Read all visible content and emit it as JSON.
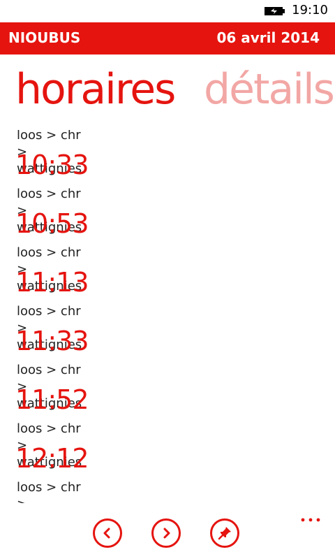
{
  "status_bar": {
    "time": "19:10",
    "battery_icon": "battery-charging-icon"
  },
  "app_bar": {
    "title": "NIOUBUS",
    "date": "06 avril 2014",
    "color": "#e5140f"
  },
  "pivot": {
    "tabs": [
      {
        "label": "horaires",
        "active": true
      },
      {
        "label": "détails",
        "active": false
      }
    ],
    "active_color": "#e5140f",
    "inactive_color": "#f2a7a5"
  },
  "schedule": {
    "partial_top_route": "loos > chr > wattignies",
    "items": [
      {
        "time": "10:33",
        "route": "loos > chr > wattignies"
      },
      {
        "time": "10:53",
        "route": "loos > chr > wattignies"
      },
      {
        "time": "11:13",
        "route": "loos > chr > wattignies"
      },
      {
        "time": "11:33",
        "route": "loos > chr > wattignies"
      },
      {
        "time": "11:52",
        "route": "loos > chr > wattignies"
      },
      {
        "time": "12:12",
        "route": "loos > chr > wattignies"
      }
    ]
  },
  "bottom_bar": {
    "buttons": [
      {
        "name": "previous",
        "icon": "chevron-left-icon"
      },
      {
        "name": "next",
        "icon": "chevron-right-icon"
      },
      {
        "name": "pin",
        "icon": "pin-icon"
      }
    ],
    "more_icon": "more-dots-icon"
  }
}
